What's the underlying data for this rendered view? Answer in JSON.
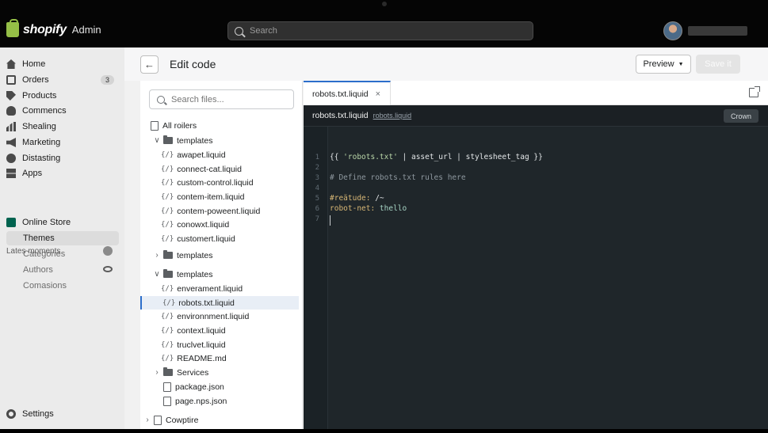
{
  "topbar": {
    "brand": "shopify",
    "admin_label": "Admin",
    "search_placeholder": "Search"
  },
  "leftnav": {
    "items": [
      {
        "label": "Home",
        "icon": "home-icon"
      },
      {
        "label": "Orders",
        "icon": "orders-icon",
        "badge": "3"
      },
      {
        "label": "Products",
        "icon": "tag-icon"
      },
      {
        "label": "Commencs",
        "icon": "person-icon"
      },
      {
        "label": "Shealing",
        "icon": "bar-chart-icon"
      },
      {
        "label": "Marketing",
        "icon": "megaphone-icon"
      },
      {
        "label": "Distasting",
        "icon": "discount-icon"
      },
      {
        "label": "Apps",
        "icon": "apps-icon"
      }
    ],
    "section_label": "Lates moments",
    "online_store": "Online Store",
    "sub_items": [
      "Themes",
      "Categories",
      "Authors",
      "Comasions"
    ],
    "settings": "Settings"
  },
  "header": {
    "title": "Edit code",
    "preview_label": "Preview",
    "save_label": "Save it"
  },
  "files": {
    "search_placeholder": "Search files...",
    "root": "All roilers",
    "rows": [
      {
        "label": "templates",
        "kind": "folder",
        "chev": "v"
      },
      {
        "label": "awapet.liquid",
        "kind": "liquid"
      },
      {
        "label": "connect-cat.liquid",
        "kind": "liquid"
      },
      {
        "label": "custom-control.liquid",
        "kind": "liquid"
      },
      {
        "label": "contem-item.liquid",
        "kind": "liquid"
      },
      {
        "label": "contem-poweent.liquid",
        "kind": "liquid"
      },
      {
        "label": "conowxt.liquid",
        "kind": "liquid"
      },
      {
        "label": "customert.liquid",
        "kind": "liquid"
      },
      {
        "label": "templates",
        "kind": "folder",
        "chev": ">"
      },
      {
        "label": "templates",
        "kind": "folder",
        "chev": "v"
      },
      {
        "label": "enverament.liquid",
        "kind": "liquid"
      },
      {
        "label": "robots.txt.liquid",
        "kind": "liquid",
        "selected": true
      },
      {
        "label": "environnment.liquid",
        "kind": "liquid"
      },
      {
        "label": "context.liquid",
        "kind": "liquid"
      },
      {
        "label": "truclvet.liquid",
        "kind": "liquid"
      },
      {
        "label": "README.md",
        "kind": "liquid"
      },
      {
        "label": "Services",
        "kind": "folder",
        "chev": ">"
      },
      {
        "label": "package.json",
        "kind": "file"
      },
      {
        "label": "page.nps.json",
        "kind": "file"
      },
      {
        "label": "Cowptire",
        "kind": "file",
        "chev": ">"
      }
    ],
    "liquid_glyph": "{/}"
  },
  "editor": {
    "tab_label": "robots.txt.liquid",
    "tab_close": "×",
    "file_name": "robots.txt.liquid",
    "file_link": "robots.liquid",
    "crown_label": "Crown",
    "line_numbers": [
      "1",
      "2",
      "3",
      "4",
      "5",
      "6",
      "7"
    ],
    "lines": {
      "l1_a": "{{ ",
      "l1_str": "'robots.txt'",
      "l1_b": " | asset_url | stylesheet_tag }}",
      "l3": "# Define robots.txt rules here",
      "l5_key": "#reätude:",
      "l5_val": " /~",
      "l6_key": "robot-net:",
      "l6_val": " thello"
    }
  }
}
